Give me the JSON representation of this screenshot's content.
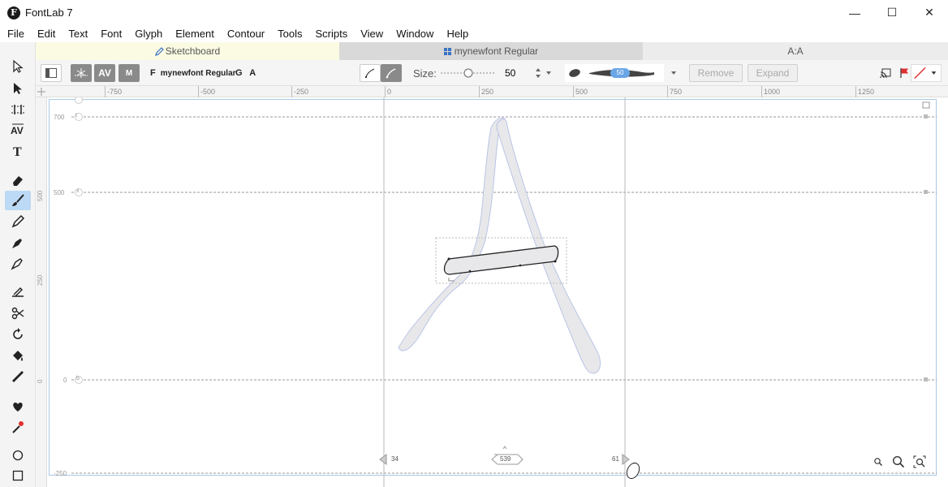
{
  "app": {
    "logo_letter": "F",
    "title": "FontLab 7"
  },
  "window_controls": {
    "minimize": "—",
    "maximize": "☐",
    "close": "✕"
  },
  "menu": [
    "File",
    "Edit",
    "Text",
    "Font",
    "Glyph",
    "Element",
    "Contour",
    "Tools",
    "Scripts",
    "View",
    "Window",
    "Help"
  ],
  "tabs": {
    "sketchboard": "Sketchboard",
    "font": "mynewfont Regular",
    "glyph": "A:A"
  },
  "propbar": {
    "font_icon": "F",
    "font_name": "mynewfont Regular",
    "glyph_letters": "G A",
    "size_label": "Size:",
    "size_value": "50",
    "brush_badge": "50",
    "remove_label": "Remove",
    "expand_label": "Expand"
  },
  "ruler_h": [
    "-750",
    "-500",
    "-250",
    "0",
    "250",
    "500",
    "750",
    "1000",
    "1250"
  ],
  "ruler_v": [
    "500",
    "250",
    "0"
  ],
  "metrics": {
    "ascender": "700",
    "xheight": "500",
    "baseline": "0",
    "descender": "-250",
    "ascender_marker": "t",
    "xheight_marker": "x",
    "baseline_marker": "b",
    "lsb": "34",
    "advance": "539",
    "rsb": "61"
  },
  "colors": {
    "active_tool": "#bcd9f5",
    "sketch_tab": "#fbfbe3",
    "red_flag": "#e03030",
    "glyph_fill": "#e8e8ea",
    "glyph_outline": "#b9c5e6"
  }
}
